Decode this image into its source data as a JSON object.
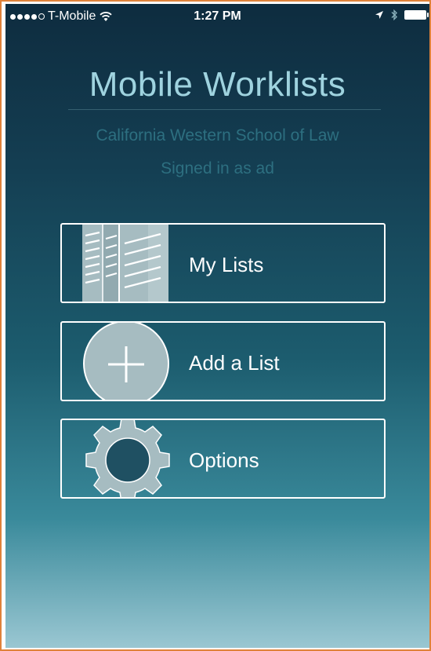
{
  "status_bar": {
    "carrier": "T-Mobile",
    "time": "1:27 PM"
  },
  "header": {
    "title": "Mobile Worklists",
    "school": "California Western School of Law",
    "signed_in": "Signed in as ad"
  },
  "menu": [
    {
      "label": "My Lists",
      "icon": "lists-icon"
    },
    {
      "label": "Add a List",
      "icon": "plus-circle-icon"
    },
    {
      "label": "Options",
      "icon": "gear-icon"
    }
  ],
  "colors": {
    "title": "#9fd3df",
    "subtitle": "#2d6f80",
    "icon_fill": "#a6bcc1",
    "frame_border": "#e0823a"
  }
}
